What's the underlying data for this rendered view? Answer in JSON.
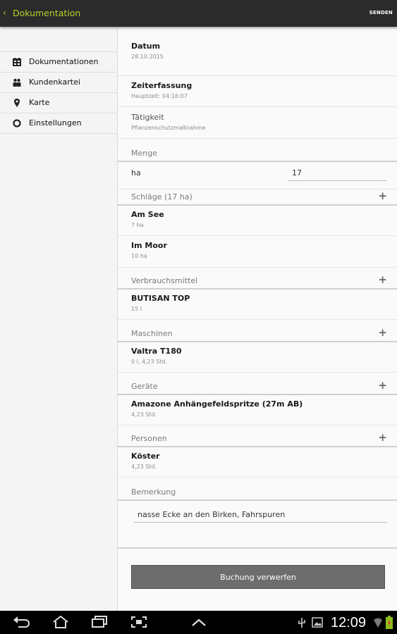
{
  "actionbar": {
    "back_glyph": "‹",
    "title": "Dokumentation",
    "send_label": "SENDEN",
    "accent": "#b5d22a"
  },
  "sidebar": {
    "items": [
      {
        "label": "Dokumentationen",
        "icon": "documents-icon"
      },
      {
        "label": "Kundenkartei",
        "icon": "people-icon"
      },
      {
        "label": "Karte",
        "icon": "map-pin-icon"
      },
      {
        "label": "Einstellungen",
        "icon": "settings-icon"
      }
    ]
  },
  "main": {
    "datum": {
      "title": "Datum",
      "value": "28.10.2015"
    },
    "zeiterfassung": {
      "title": "Zeiterfassung",
      "value": "Hauptzeit: 04:16:07"
    },
    "taetigkeit": {
      "title": "Tätigkeit",
      "value": "Pflanzenschutzmaßnahme"
    },
    "menge": {
      "header": "Menge",
      "unit": "ha",
      "value": "17"
    },
    "schlaege": {
      "header": "Schläge (17 ha)",
      "items": [
        {
          "title": "Am See",
          "sub": "7 ha"
        },
        {
          "title": "Im Moor",
          "sub": "10 ha"
        }
      ]
    },
    "verbrauchsmittel": {
      "header": "Verbrauchsmittel",
      "items": [
        {
          "title": "BUTISAN TOP",
          "sub": "15 l"
        }
      ]
    },
    "maschinen": {
      "header": "Maschinen",
      "items": [
        {
          "title": "Valtra T180",
          "sub": "0 l, 4,23 Std."
        }
      ]
    },
    "geraete": {
      "header": "Geräte",
      "items": [
        {
          "title": "Amazone Anhängefeldspritze (27m AB)",
          "sub": "4,23 Std."
        }
      ]
    },
    "personen": {
      "header": "Personen",
      "items": [
        {
          "title": "Köster",
          "sub": "4,23 Std."
        }
      ]
    },
    "bemerkung": {
      "header": "Bemerkung",
      "value": "nasse Ecke an den Birken, Fahrspuren"
    },
    "discard_label": "Buchung verwerfen"
  },
  "system": {
    "time": "12:09"
  }
}
